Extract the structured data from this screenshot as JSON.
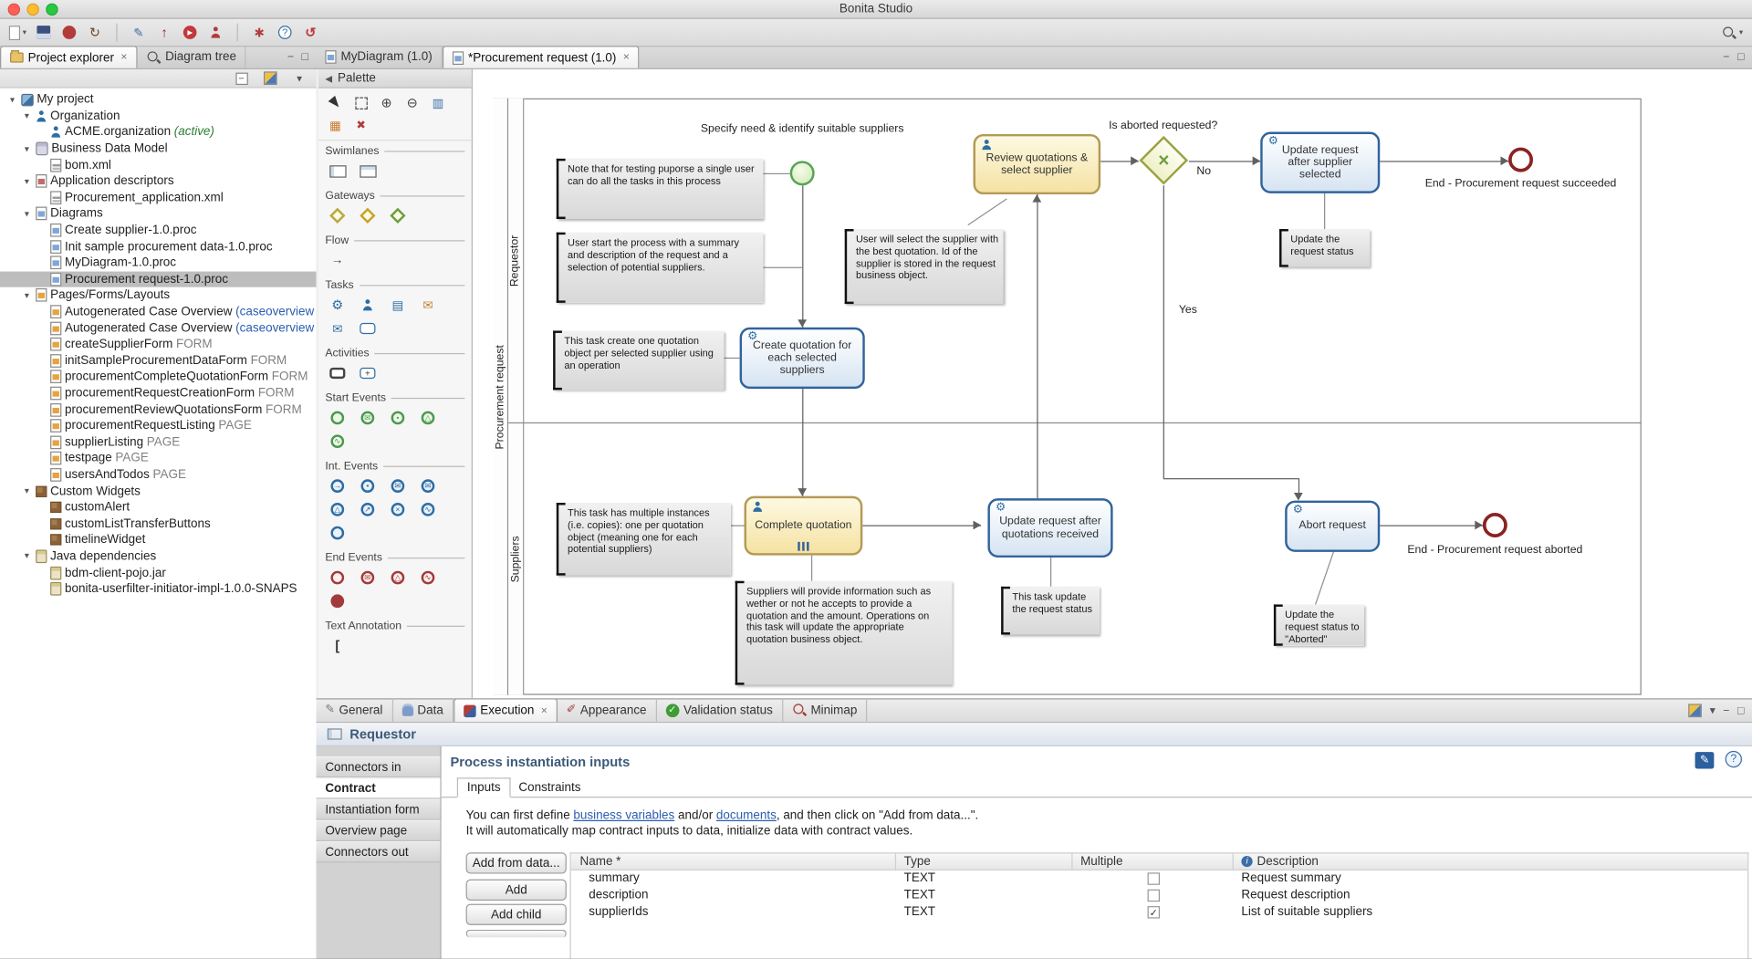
{
  "window": {
    "title": "Bonita Studio"
  },
  "toolbar": {
    "items": [
      {
        "icon": "new",
        "caret": true
      },
      {
        "icon": "save"
      },
      {
        "icon": "open"
      },
      {
        "icon": "refresh"
      },
      {
        "sep": true
      },
      {
        "icon": "edit"
      },
      {
        "icon": "export"
      },
      {
        "icon": "run"
      },
      {
        "icon": "organization"
      },
      {
        "sep": true
      },
      {
        "icon": "configure"
      },
      {
        "icon": "help"
      },
      {
        "icon": "ui-designer"
      },
      {
        "spacer": true
      },
      {
        "icon": "search",
        "caret": true
      }
    ]
  },
  "left_panel": {
    "tabs": [
      {
        "label": "Project explorer",
        "icon": "explorer",
        "active": true,
        "closable": true
      },
      {
        "label": "Diagram tree",
        "icon": "magnifier",
        "active": false
      }
    ],
    "toolbar_icons": [
      "collapse-all",
      "link-editor",
      "view-menu"
    ],
    "tree": [
      {
        "label": "My project",
        "level": 0,
        "icon": "project",
        "expanded": true
      },
      {
        "label": "Organization",
        "level": 1,
        "icon": "organization",
        "expanded": true
      },
      {
        "label": "ACME.organization",
        "suffix": " (active)",
        "suffix_style": "active",
        "level": 2,
        "icon": "organization"
      },
      {
        "label": "Business Data Model",
        "level": 1,
        "icon": "bdm",
        "expanded": true
      },
      {
        "label": "bom.xml",
        "level": 2,
        "icon": "xml"
      },
      {
        "label": "Application descriptors",
        "level": 1,
        "icon": "appdesc",
        "expanded": true
      },
      {
        "label": "Procurement_application.xml",
        "level": 2,
        "icon": "xml"
      },
      {
        "label": "Diagrams",
        "level": 1,
        "icon": "diagrams",
        "expanded": true
      },
      {
        "label": "Create supplier-1.0.proc",
        "level": 2,
        "icon": "proc"
      },
      {
        "label": "Init sample procurement data-1.0.proc",
        "level": 2,
        "icon": "proc"
      },
      {
        "label": "MyDiagram-1.0.proc",
        "level": 2,
        "icon": "proc"
      },
      {
        "label": "Procurement request-1.0.proc",
        "level": 2,
        "icon": "proc",
        "selected": true
      },
      {
        "label": "Pages/Forms/Layouts",
        "level": 1,
        "icon": "pages",
        "expanded": true
      },
      {
        "label": "Autogenerated Case Overview",
        "suffix": " (caseoverview",
        "suffix_style": "link",
        "level": 2,
        "icon": "form"
      },
      {
        "label": "Autogenerated Case Overview",
        "suffix": " (caseoverview",
        "suffix_style": "link",
        "level": 2,
        "icon": "form"
      },
      {
        "label": "createSupplierForm",
        "suffix": " FORM",
        "suffix_style": "dim",
        "level": 2,
        "icon": "form"
      },
      {
        "label": "initSampleProcurementDataForm",
        "suffix": " FORM",
        "suffix_style": "dim",
        "level": 2,
        "icon": "form"
      },
      {
        "label": "procurementCompleteQuotationForm",
        "suffix": " FORM",
        "suffix_style": "dim",
        "level": 2,
        "icon": "form"
      },
      {
        "label": "procurementRequestCreationForm",
        "suffix": " FORM",
        "suffix_style": "dim",
        "level": 2,
        "icon": "form"
      },
      {
        "label": "procurementReviewQuotationsForm",
        "suffix": " FORM",
        "suffix_style": "dim",
        "level": 2,
        "icon": "form"
      },
      {
        "label": "procurementRequestListing",
        "suffix": " PAGE",
        "suffix_style": "dim",
        "level": 2,
        "icon": "form"
      },
      {
        "label": "supplierListing",
        "suffix": " PAGE",
        "suffix_style": "dim",
        "level": 2,
        "icon": "form"
      },
      {
        "label": "testpage",
        "suffix": " PAGE",
        "suffix_style": "dim",
        "level": 2,
        "icon": "form"
      },
      {
        "label": "usersAndTodos",
        "suffix": " PAGE",
        "suffix_style": "dim",
        "level": 2,
        "icon": "form"
      },
      {
        "label": "Custom Widgets",
        "level": 1,
        "icon": "widgets",
        "expanded": true
      },
      {
        "label": "customAlert",
        "level": 2,
        "icon": "widget"
      },
      {
        "label": "customListTransferButtons",
        "level": 2,
        "icon": "widget"
      },
      {
        "label": "timelineWidget",
        "level": 2,
        "icon": "widget"
      },
      {
        "label": "Java dependencies",
        "level": 1,
        "icon": "java",
        "expanded": true
      },
      {
        "label": "bdm-client-pojo.jar",
        "level": 2,
        "icon": "jar"
      },
      {
        "label": "bonita-userfilter-initiator-impl-1.0.0-SNAPS",
        "level": 2,
        "icon": "jar"
      }
    ]
  },
  "editor": {
    "tabs": [
      {
        "label": "MyDiagram (1.0)",
        "icon": "proc",
        "active": false
      },
      {
        "label": "*Procurement request (1.0)",
        "icon": "proc",
        "active": true,
        "closable": true
      }
    ],
    "palette": {
      "title": "Palette",
      "tools": [
        "select",
        "marquee",
        "zoom-in",
        "zoom-out",
        "align",
        "distribute",
        "delete"
      ],
      "sections": [
        {
          "name": "Swimlanes",
          "icons": [
            "pool-horizontal",
            "pool-vertical"
          ]
        },
        {
          "name": "Gateways",
          "icons": [
            "gateway-xor",
            "gateway-and",
            "gateway-or"
          ]
        },
        {
          "name": "Flow",
          "icons": [
            "sequence-flow"
          ]
        },
        {
          "name": "Tasks",
          "icons": [
            "service-task",
            "human-task",
            "script-task",
            "send-task",
            "receive-task",
            "abstract-task"
          ]
        },
        {
          "name": "Activities",
          "icons": [
            "call-activity",
            "subprocess"
          ]
        },
        {
          "name": "Start Events",
          "icons": [
            "start-event",
            "start-message",
            "start-timer",
            "start-signal",
            "start-error"
          ]
        },
        {
          "name": "Int. Events",
          "icons": [
            "catch-link",
            "intermediate-timer",
            "catch-message",
            "throw-message",
            "catch-signal",
            "throw-link",
            "cancel-event",
            "error-event",
            "intermediate-event"
          ]
        },
        {
          "name": "End Events",
          "icons": [
            "end-event",
            "end-message",
            "end-signal",
            "end-error",
            "terminate-event"
          ]
        },
        {
          "name": "Text Annotation",
          "icons": [
            "text-annotation"
          ]
        }
      ]
    },
    "diagram": {
      "pool": "Procurement request",
      "lanes": {
        "top": "Requestor",
        "bottom": "Suppliers"
      },
      "start_event": {
        "label": "Specify need & identify suitable suppliers"
      },
      "tasks": {
        "create": {
          "label": "Create quotation for each selected suppliers"
        },
        "review": {
          "label": "Review quotations & select supplier"
        },
        "update_supplier": {
          "label": "Update request after supplier selected"
        },
        "complete": {
          "label": "Complete quotation"
        },
        "update_quotations": {
          "label": "Update request after quotations received"
        },
        "abort": {
          "label": "Abort request"
        }
      },
      "gateway": {
        "label": "Is aborted requested?",
        "yes": "Yes",
        "no": "No"
      },
      "end_events": {
        "succeeded": {
          "label": "End - Procurement request succeeded"
        },
        "aborted": {
          "label": "End - Procurement request aborted"
        }
      },
      "notes": {
        "n1": "Note that for testing puporse a single user can do all the tasks in this process",
        "n2": "User start the process with a summary and description of the request and a selection of potential suppliers.",
        "n3": "This task create one quotation object per selected supplier using an operation",
        "n4": "User will select the supplier with the best quotation. Id of the supplier is stored in the request business object.",
        "n5": "Update the request status",
        "n6": "This task has multiple instances (i.e. copies): one per quotation object (meaning one for each potential suppliers)",
        "n7": "Suppliers will provide information such as wether or not he accepts to provide a quotation and the amount. Operations on this task will update the appropriate quotation business object.",
        "n8": "This task update the request status",
        "n9": "Update the request status to \"Aborted\""
      }
    }
  },
  "bottom_panel": {
    "tabs": [
      {
        "label": "General",
        "icon": "general"
      },
      {
        "label": "Data",
        "icon": "data"
      },
      {
        "label": "Execution",
        "icon": "execution",
        "active": true,
        "closable": true
      },
      {
        "label": "Appearance",
        "icon": "appearance"
      },
      {
        "label": "Validation status",
        "icon": "validation"
      },
      {
        "label": "Minimap",
        "icon": "minimap"
      }
    ],
    "header": "Requestor",
    "nav": [
      {
        "label": "Connectors in"
      },
      {
        "label": "Contract",
        "selected": true
      },
      {
        "label": "Instantiation form"
      },
      {
        "label": "Overview page"
      },
      {
        "label": "Connectors out"
      }
    ],
    "contract": {
      "title": "Process instantiation inputs",
      "subtabs": [
        {
          "label": "Inputs",
          "active": true
        },
        {
          "label": "Constraints"
        }
      ],
      "help1_pre": "You can first define ",
      "help1_link1": "business variables",
      "help1_mid": " and/or ",
      "help1_link2": "documents",
      "help1_post": ", and then click on \"Add from data...\".",
      "help2": "It will automatically map contract inputs to data, initialize data with contract values.",
      "buttons": [
        "Add from data...",
        "Add",
        "Add child"
      ],
      "table": {
        "columns": [
          "Name *",
          "Type",
          "Multiple",
          "Description"
        ],
        "rows": [
          {
            "name": "summary",
            "type": "TEXT",
            "multiple": false,
            "description": "Request summary"
          },
          {
            "name": "description",
            "type": "TEXT",
            "multiple": false,
            "description": "Request description"
          },
          {
            "name": "supplierIds",
            "type": "TEXT",
            "multiple": true,
            "description": "List of suitable suppliers"
          }
        ]
      }
    }
  }
}
